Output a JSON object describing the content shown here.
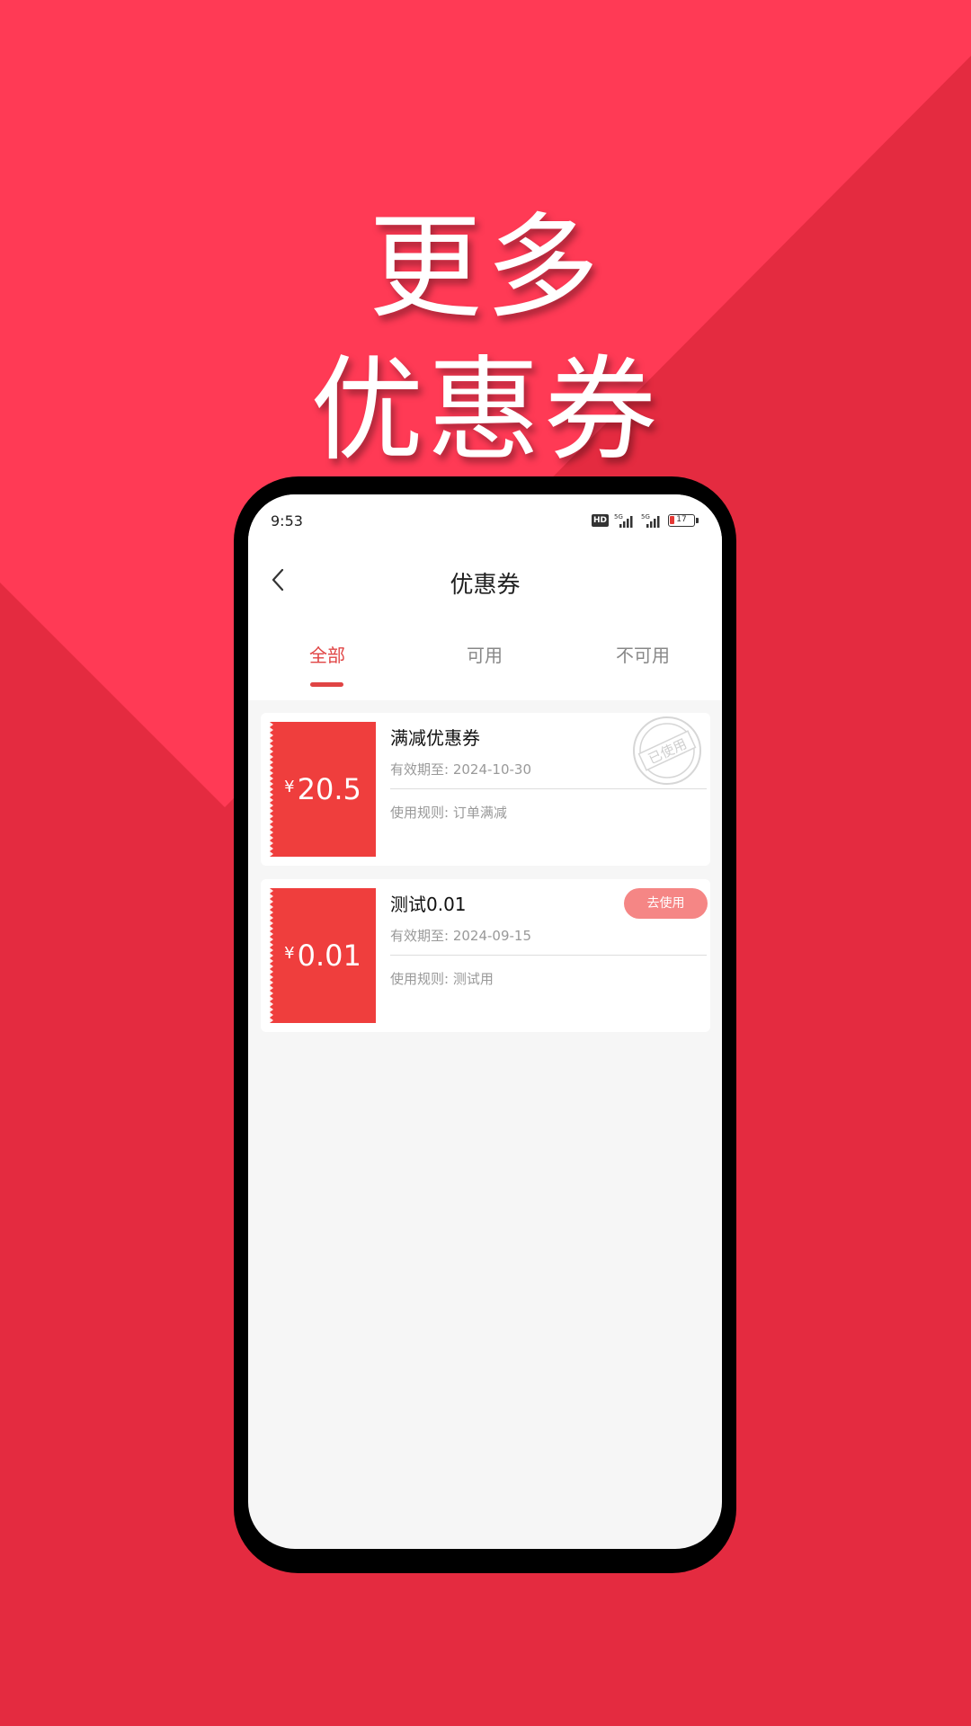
{
  "promo": {
    "headline_line1": "更多",
    "headline_line2": "优惠券",
    "background_color": "#E42B40",
    "highlight_color": "#FF3A55"
  },
  "status_bar": {
    "time": "9:53",
    "hd_label": "HD",
    "battery_level": "17"
  },
  "header": {
    "title": "优惠券",
    "back_icon": "chevron-left-icon"
  },
  "tabs": [
    {
      "label": "全部",
      "active": true
    },
    {
      "label": "可用",
      "active": false
    },
    {
      "label": "不可用",
      "active": false
    }
  ],
  "coupons": [
    {
      "currency": "¥",
      "amount": "20.5",
      "title": "满减优惠券",
      "expiry": "有效期至: 2024-10-30",
      "rule": "使用规则: 订单满减",
      "status": "used",
      "stamp_label": "已使用"
    },
    {
      "currency": "¥",
      "amount": "0.01",
      "title": "测试0.01",
      "expiry": "有效期至: 2024-09-15",
      "rule": "使用规则: 测试用",
      "status": "available",
      "action_label": "去使用"
    }
  ],
  "colors": {
    "accent": "#E04444",
    "coupon_stub": "#EF3E3D",
    "use_button": "#F58685"
  }
}
